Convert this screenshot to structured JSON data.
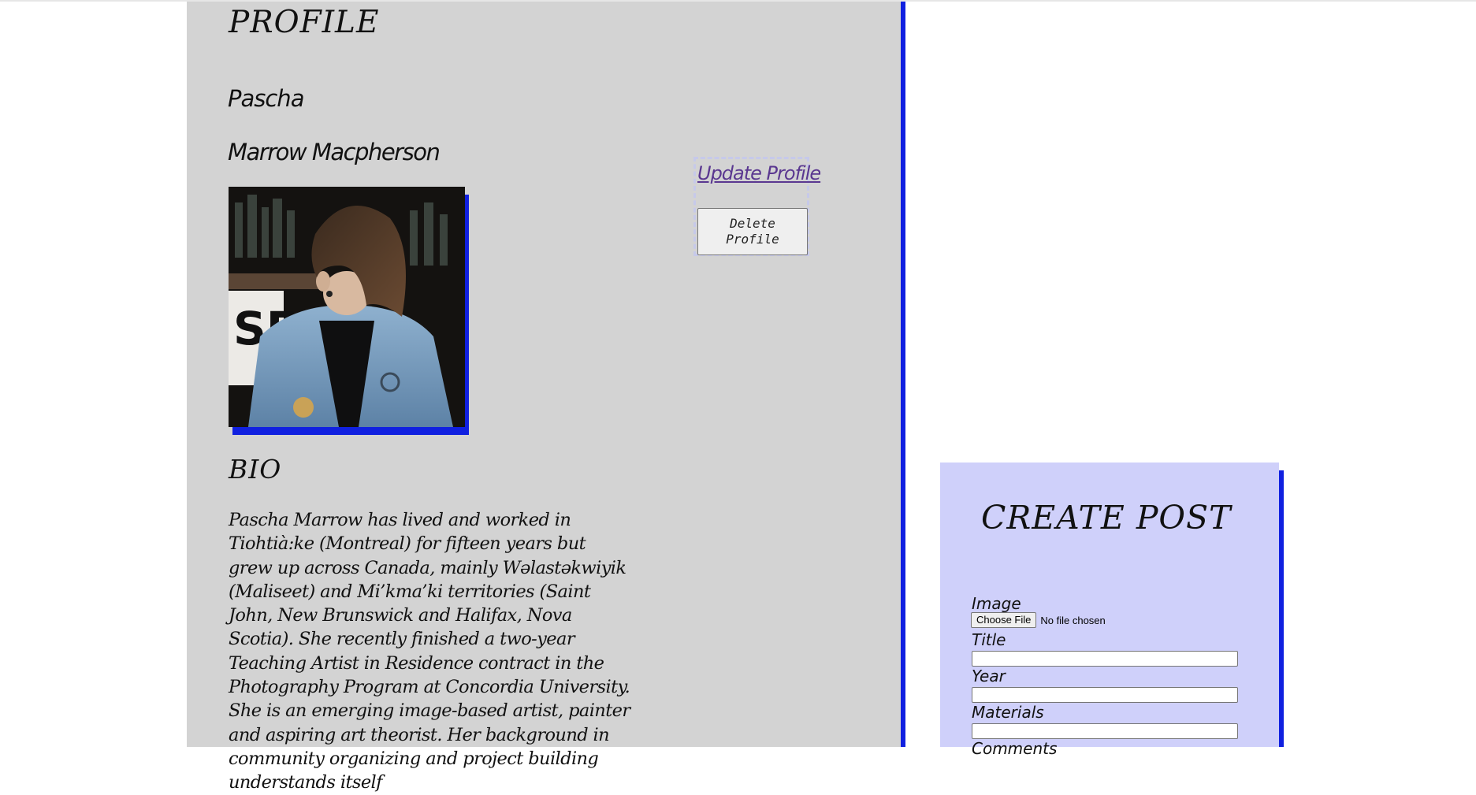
{
  "profile": {
    "heading": "PROFILE",
    "first_name": "Pascha",
    "full_name": "Marrow Macpherson",
    "photo_alt": "",
    "update_link": "Update Profile",
    "delete_button": "Delete Profile"
  },
  "bio": {
    "heading": "BIO",
    "text": "Pascha Marrow has lived and worked in Tiohtià:ke (Montreal) for fifteen years but grew up across Canada, mainly Wəlastəkwiyik (Maliseet) and Mi’kma’ki territories (Saint John, New Brunswick and Halifax, Nova Scotia). She recently finished a two-year Teaching Artist in Residence contract in the Photography Program at Concordia University. She is an emerging image-based artist, painter and aspiring art theorist. Her background in community organizing and project building understands itself"
  },
  "create_post": {
    "heading": "CREATE POST",
    "image_label": "Image",
    "file_button": "Choose File",
    "file_status": "No file chosen",
    "title_label": "Title",
    "year_label": "Year",
    "materials_label": "Materials",
    "comments_label": "Comments"
  },
  "colors": {
    "accent_blue": "#1020e0",
    "left_panel_bg": "#d3d3d3",
    "post_panel_bg": "#cfd0fa",
    "link_color": "#5a3790"
  }
}
